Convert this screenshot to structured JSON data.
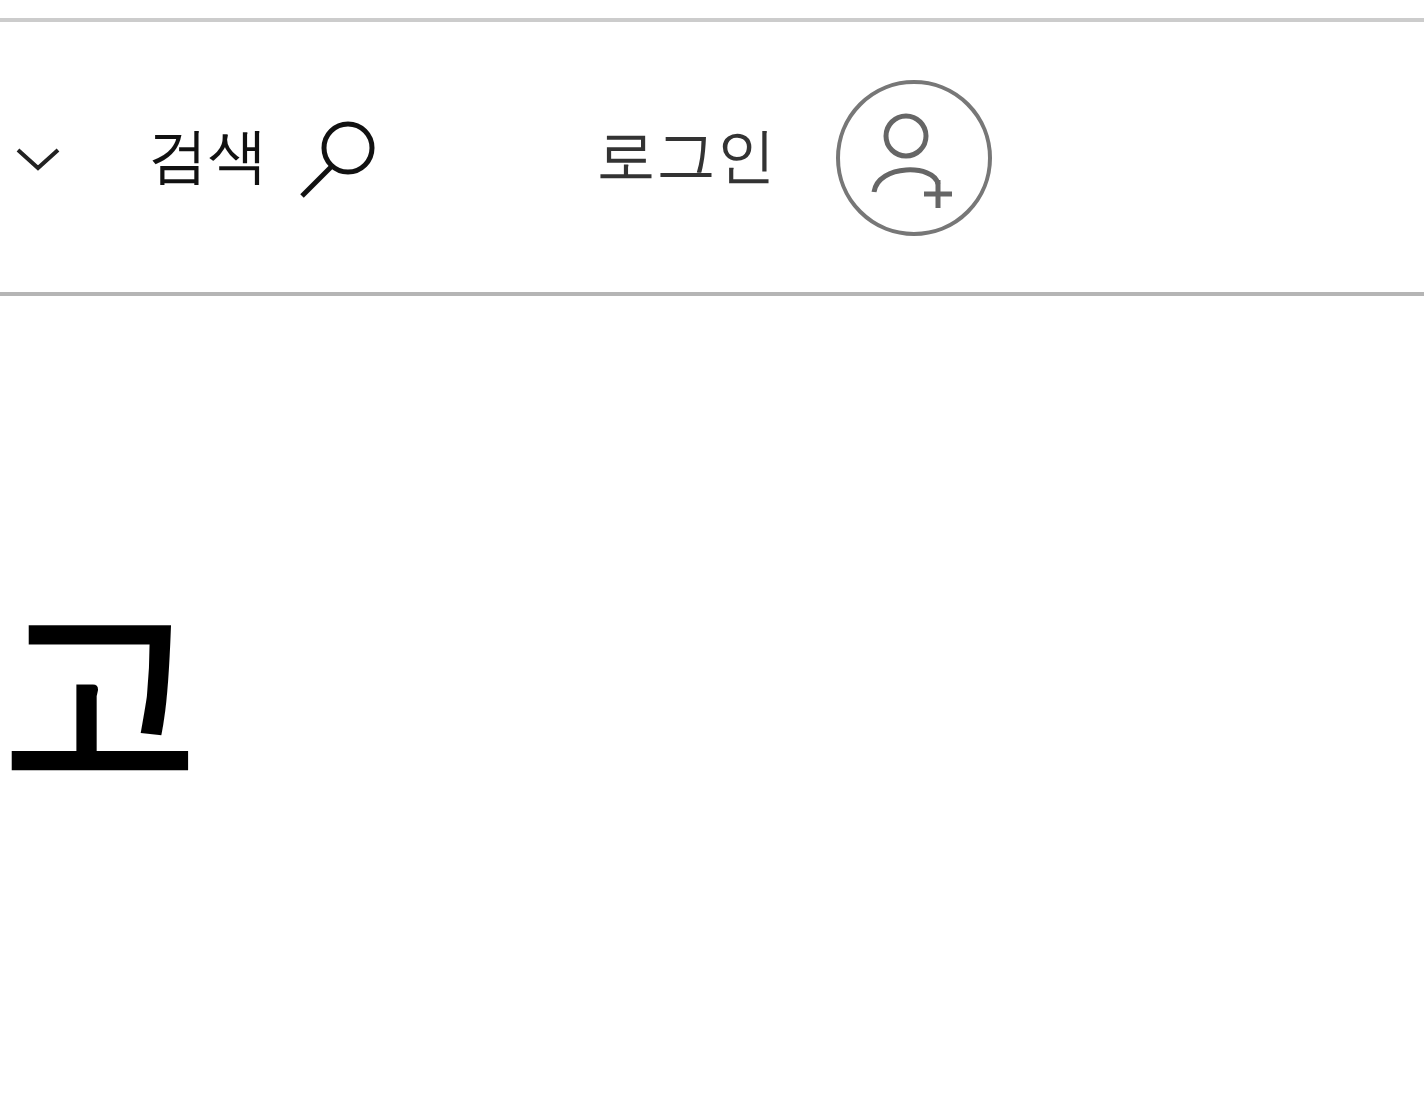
{
  "header": {
    "search": {
      "label": "검색"
    },
    "login": {
      "label": "로그인"
    }
  },
  "heading": {
    "text": "고"
  }
}
